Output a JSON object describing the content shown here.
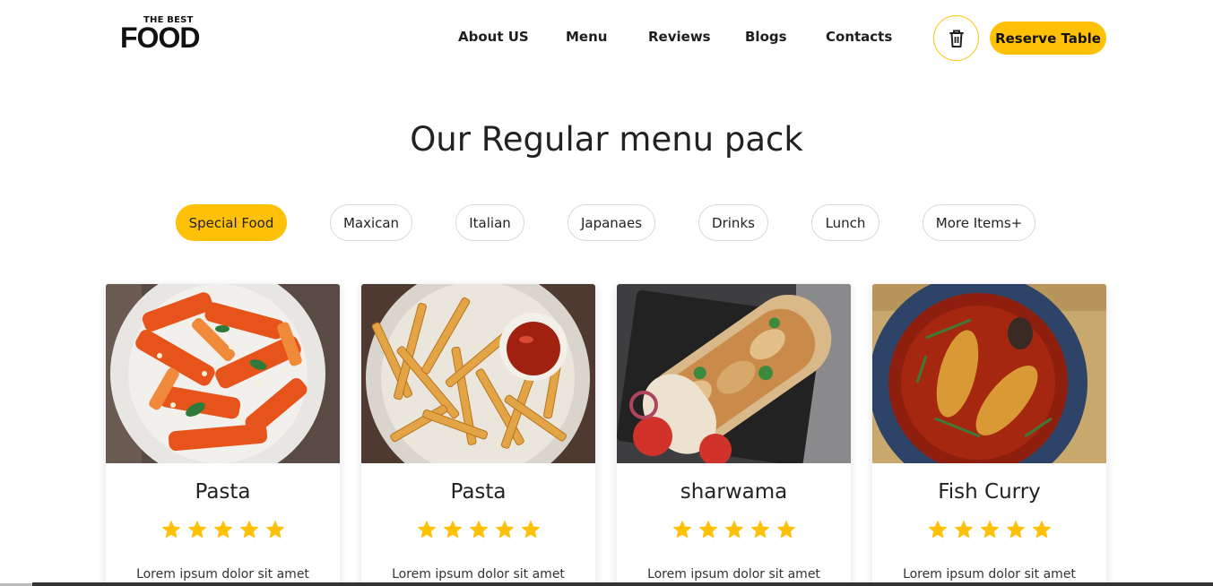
{
  "brand": {
    "logo_small": "THE BEST",
    "logo_big": "FOOD"
  },
  "nav": {
    "items": [
      {
        "label": "About US"
      },
      {
        "label": "Menu"
      },
      {
        "label": "Reviews"
      },
      {
        "label": "Blogs"
      },
      {
        "label": "Contacts"
      }
    ],
    "cart_icon": "trash-icon",
    "reserve_label": "Reserve Table"
  },
  "menu_section": {
    "title": "Our Regular menu pack",
    "filters": [
      {
        "label": "Special Food",
        "active": true
      },
      {
        "label": "Maxican",
        "active": false
      },
      {
        "label": "Italian",
        "active": false
      },
      {
        "label": "Japanaes",
        "active": false
      },
      {
        "label": "Drinks",
        "active": false
      },
      {
        "label": "Lunch",
        "active": false
      },
      {
        "label": "More Items+",
        "active": false
      }
    ],
    "cards": [
      {
        "title": "Pasta",
        "rating": 5,
        "desc": "Lorem ipsum dolor sit amet",
        "image": "pasta-image"
      },
      {
        "title": "Pasta",
        "rating": 5,
        "desc": "Lorem ipsum dolor sit amet",
        "image": "fries-image"
      },
      {
        "title": "sharwama",
        "rating": 5,
        "desc": "Lorem ipsum dolor sit amet",
        "image": "shawarma-image"
      },
      {
        "title": "Fish Curry",
        "rating": 5,
        "desc": "Lorem ipsum dolor sit amet",
        "image": "fish-curry-image"
      }
    ]
  },
  "colors": {
    "accent": "#ffc107",
    "text": "#1e1e1e",
    "pill_border": "#d9d9d9"
  }
}
